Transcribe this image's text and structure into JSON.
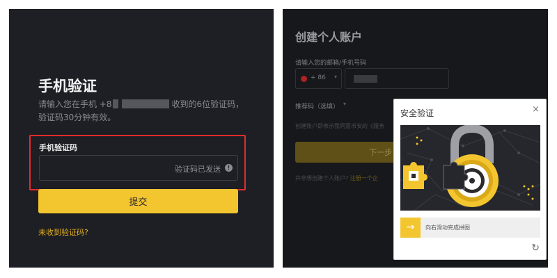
{
  "verify": {
    "title": "手机验证",
    "desc_part1": "请输入您在手机 +8",
    "desc_part2": "收到的6位验证码，",
    "desc_line2": "验证码30分钟有效。",
    "code_label": "手机验证码",
    "code_status": "验证码已发送",
    "info_icon": "!",
    "submit_label": "提交",
    "no_code_link": "未收到验证码?"
  },
  "register": {
    "title": "创建个人账户",
    "input_label": "请输入您的邮箱/手机号码",
    "country_code": "+ 86",
    "chevron": "▾",
    "referral_label": "推荐码（选填）",
    "terms_text": "创建账户即表示我同意币安的《服务",
    "next_label": "下一步",
    "corp_text": "并非想创建个人账户?",
    "corp_link": "注册一个企"
  },
  "captcha": {
    "title": "安全验证",
    "close_icon": "×",
    "slider_icon": "→",
    "slider_hint": "向右滑动完成拼图",
    "refresh_icon": "↻"
  },
  "colors": {
    "accent": "#f3c52f",
    "highlight_border": "#e12d2d",
    "dark_bg": "#1e1f24"
  }
}
